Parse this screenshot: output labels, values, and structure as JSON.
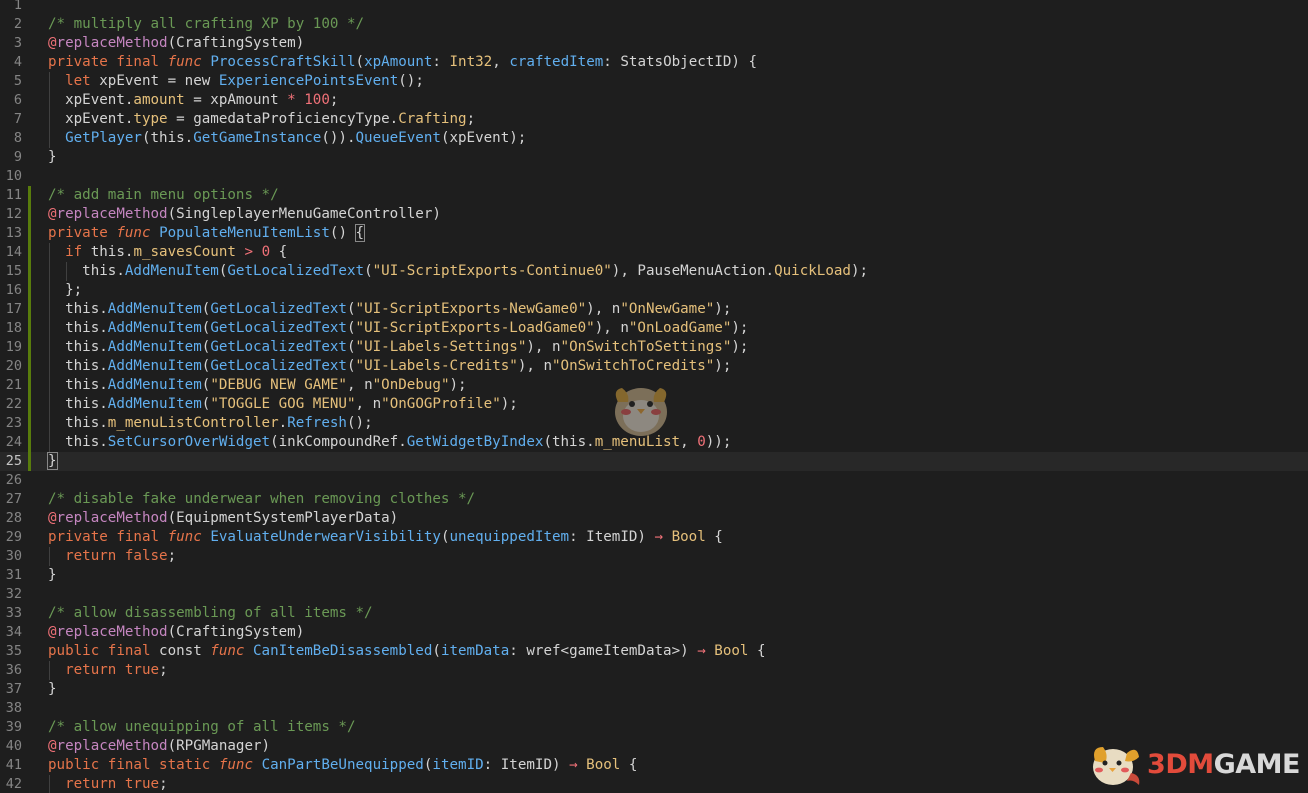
{
  "editor": {
    "current_line": 25,
    "lines": [
      {
        "n": "1",
        "tokens": []
      },
      {
        "n": "2",
        "tokens": [
          [
            "c",
            "/* multiply all crafting XP by 100 */"
          ]
        ]
      },
      {
        "n": "3",
        "tokens": [
          [
            "at",
            "@"
          ],
          [
            "d",
            "replaceMethod"
          ],
          [
            "p",
            "(CraftingSystem)"
          ]
        ]
      },
      {
        "n": "4",
        "tokens": [
          [
            "k",
            "private final "
          ],
          [
            "f",
            "func "
          ],
          [
            "fn",
            "ProcessCraftSkill"
          ],
          [
            "p",
            "("
          ],
          [
            "pa",
            "xpAmount"
          ],
          [
            "p",
            ": "
          ],
          [
            "t",
            "Int32"
          ],
          [
            "p",
            ", "
          ],
          [
            "pa",
            "craftedItem"
          ],
          [
            "p",
            ": StatsObjectID) {"
          ]
        ]
      },
      {
        "n": "5",
        "tokens": [
          [
            "p",
            "  "
          ],
          [
            "k",
            "let "
          ],
          [
            "p",
            "xpEvent = new "
          ],
          [
            "fn",
            "ExperiencePointsEvent"
          ],
          [
            "p",
            "();"
          ]
        ]
      },
      {
        "n": "6",
        "tokens": [
          [
            "p",
            "  xpEvent."
          ],
          [
            "pr",
            "amount"
          ],
          [
            "p",
            " = xpAmount "
          ],
          [
            "o",
            "*"
          ],
          [
            "p",
            " "
          ],
          [
            "nu",
            "100"
          ],
          [
            "p",
            ";"
          ]
        ]
      },
      {
        "n": "7",
        "tokens": [
          [
            "p",
            "  xpEvent."
          ],
          [
            "pr",
            "type"
          ],
          [
            "p",
            " = gamedataProficiencyType."
          ],
          [
            "pr",
            "Crafting"
          ],
          [
            "p",
            ";"
          ]
        ]
      },
      {
        "n": "8",
        "tokens": [
          [
            "p",
            "  "
          ],
          [
            "fn",
            "GetPlayer"
          ],
          [
            "p",
            "(this."
          ],
          [
            "fn",
            "GetGameInstance"
          ],
          [
            "p",
            "())."
          ],
          [
            "fn",
            "QueueEvent"
          ],
          [
            "p",
            "(xpEvent);"
          ]
        ]
      },
      {
        "n": "9",
        "tokens": [
          [
            "p",
            "}"
          ]
        ]
      },
      {
        "n": "10",
        "tokens": []
      },
      {
        "n": "11",
        "tokens": [
          [
            "c",
            "/* add main menu options */"
          ]
        ]
      },
      {
        "n": "12",
        "tokens": [
          [
            "at",
            "@"
          ],
          [
            "d",
            "replaceMethod"
          ],
          [
            "p",
            "(SingleplayerMenuGameController)"
          ]
        ]
      },
      {
        "n": "13",
        "tokens": [
          [
            "k",
            "private "
          ],
          [
            "f",
            "func "
          ],
          [
            "fn",
            "PopulateMenuItemList"
          ],
          [
            "p",
            "() "
          ],
          [
            "b",
            "{"
          ]
        ]
      },
      {
        "n": "14",
        "tokens": [
          [
            "p",
            "  "
          ],
          [
            "k",
            "if "
          ],
          [
            "p",
            "this."
          ],
          [
            "pr",
            "m_savesCount"
          ],
          [
            "p",
            " "
          ],
          [
            "o",
            ">"
          ],
          [
            "p",
            " "
          ],
          [
            "nu",
            "0"
          ],
          [
            "p",
            " {"
          ]
        ]
      },
      {
        "n": "15",
        "tokens": [
          [
            "p",
            "    this."
          ],
          [
            "fn",
            "AddMenuItem"
          ],
          [
            "p",
            "("
          ],
          [
            "fn",
            "GetLocalizedText"
          ],
          [
            "p",
            "("
          ],
          [
            "s",
            "\"UI-ScriptExports-Continue0\""
          ],
          [
            "p",
            "), PauseMenuAction."
          ],
          [
            "pr",
            "QuickLoad"
          ],
          [
            "p",
            ");"
          ]
        ]
      },
      {
        "n": "16",
        "tokens": [
          [
            "p",
            "  };"
          ]
        ]
      },
      {
        "n": "17",
        "tokens": [
          [
            "p",
            "  this."
          ],
          [
            "fn",
            "AddMenuItem"
          ],
          [
            "p",
            "("
          ],
          [
            "fn",
            "GetLocalizedText"
          ],
          [
            "p",
            "("
          ],
          [
            "s",
            "\"UI-ScriptExports-NewGame0\""
          ],
          [
            "p",
            "), n"
          ],
          [
            "s",
            "\"OnNewGame\""
          ],
          [
            "p",
            ");"
          ]
        ]
      },
      {
        "n": "18",
        "tokens": [
          [
            "p",
            "  this."
          ],
          [
            "fn",
            "AddMenuItem"
          ],
          [
            "p",
            "("
          ],
          [
            "fn",
            "GetLocalizedText"
          ],
          [
            "p",
            "("
          ],
          [
            "s",
            "\"UI-ScriptExports-LoadGame0\""
          ],
          [
            "p",
            "), n"
          ],
          [
            "s",
            "\"OnLoadGame\""
          ],
          [
            "p",
            ");"
          ]
        ]
      },
      {
        "n": "19",
        "tokens": [
          [
            "p",
            "  this."
          ],
          [
            "fn",
            "AddMenuItem"
          ],
          [
            "p",
            "("
          ],
          [
            "fn",
            "GetLocalizedText"
          ],
          [
            "p",
            "("
          ],
          [
            "s",
            "\"UI-Labels-Settings\""
          ],
          [
            "p",
            "), n"
          ],
          [
            "s",
            "\"OnSwitchToSettings\""
          ],
          [
            "p",
            ");"
          ]
        ]
      },
      {
        "n": "20",
        "tokens": [
          [
            "p",
            "  this."
          ],
          [
            "fn",
            "AddMenuItem"
          ],
          [
            "p",
            "("
          ],
          [
            "fn",
            "GetLocalizedText"
          ],
          [
            "p",
            "("
          ],
          [
            "s",
            "\"UI-Labels-Credits\""
          ],
          [
            "p",
            "), n"
          ],
          [
            "s",
            "\"OnSwitchToCredits\""
          ],
          [
            "p",
            ");"
          ]
        ]
      },
      {
        "n": "21",
        "tokens": [
          [
            "p",
            "  this."
          ],
          [
            "fn",
            "AddMenuItem"
          ],
          [
            "p",
            "("
          ],
          [
            "s",
            "\"DEBUG NEW GAME\""
          ],
          [
            "p",
            ", n"
          ],
          [
            "s",
            "\"OnDebug\""
          ],
          [
            "p",
            ");"
          ]
        ]
      },
      {
        "n": "22",
        "tokens": [
          [
            "p",
            "  this."
          ],
          [
            "fn",
            "AddMenuItem"
          ],
          [
            "p",
            "("
          ],
          [
            "s",
            "\"TOGGLE GOG MENU\""
          ],
          [
            "p",
            ", n"
          ],
          [
            "s",
            "\"OnGOGProfile\""
          ],
          [
            "p",
            ");"
          ]
        ]
      },
      {
        "n": "23",
        "tokens": [
          [
            "p",
            "  this."
          ],
          [
            "pr",
            "m_menuListController"
          ],
          [
            "p",
            "."
          ],
          [
            "fn",
            "Refresh"
          ],
          [
            "p",
            "();"
          ]
        ]
      },
      {
        "n": "24",
        "tokens": [
          [
            "p",
            "  this."
          ],
          [
            "fn",
            "SetCursorOverWidget"
          ],
          [
            "p",
            "(inkCompoundRef."
          ],
          [
            "fn",
            "GetWidgetByIndex"
          ],
          [
            "p",
            "(this."
          ],
          [
            "pr",
            "m_menuList"
          ],
          [
            "p",
            ", "
          ],
          [
            "nu",
            "0"
          ],
          [
            "p",
            "));"
          ]
        ]
      },
      {
        "n": "25",
        "tokens": [
          [
            "b",
            "}"
          ]
        ]
      },
      {
        "n": "26",
        "tokens": []
      },
      {
        "n": "27",
        "tokens": [
          [
            "c",
            "/* disable fake underwear when removing clothes */"
          ]
        ]
      },
      {
        "n": "28",
        "tokens": [
          [
            "at",
            "@"
          ],
          [
            "d",
            "replaceMethod"
          ],
          [
            "p",
            "(EquipmentSystemPlayerData)"
          ]
        ]
      },
      {
        "n": "29",
        "tokens": [
          [
            "k",
            "private final "
          ],
          [
            "f",
            "func "
          ],
          [
            "fn",
            "EvaluateUnderwearVisibility"
          ],
          [
            "p",
            "("
          ],
          [
            "pa",
            "unequippedItem"
          ],
          [
            "p",
            ": ItemID) "
          ],
          [
            "o",
            "→"
          ],
          [
            "p",
            " "
          ],
          [
            "t",
            "Bool"
          ],
          [
            "p",
            " {"
          ]
        ]
      },
      {
        "n": "30",
        "tokens": [
          [
            "p",
            "  "
          ],
          [
            "k",
            "return "
          ],
          [
            "k",
            "false"
          ],
          [
            "p",
            ";"
          ]
        ]
      },
      {
        "n": "31",
        "tokens": [
          [
            "p",
            "}"
          ]
        ]
      },
      {
        "n": "32",
        "tokens": []
      },
      {
        "n": "33",
        "tokens": [
          [
            "c",
            "/* allow disassembling of all items */"
          ]
        ]
      },
      {
        "n": "34",
        "tokens": [
          [
            "at",
            "@"
          ],
          [
            "d",
            "replaceMethod"
          ],
          [
            "p",
            "(CraftingSystem)"
          ]
        ]
      },
      {
        "n": "35",
        "tokens": [
          [
            "k",
            "public final "
          ],
          [
            "p",
            "const "
          ],
          [
            "f",
            "func "
          ],
          [
            "fn",
            "CanItemBeDisassembled"
          ],
          [
            "p",
            "("
          ],
          [
            "pa",
            "itemData"
          ],
          [
            "p",
            ": wref<gameItemData>) "
          ],
          [
            "o",
            "→"
          ],
          [
            "p",
            " "
          ],
          [
            "t",
            "Bool"
          ],
          [
            "p",
            " {"
          ]
        ]
      },
      {
        "n": "36",
        "tokens": [
          [
            "p",
            "  "
          ],
          [
            "k",
            "return "
          ],
          [
            "k",
            "true"
          ],
          [
            "p",
            ";"
          ]
        ]
      },
      {
        "n": "37",
        "tokens": [
          [
            "p",
            "}"
          ]
        ]
      },
      {
        "n": "38",
        "tokens": []
      },
      {
        "n": "39",
        "tokens": [
          [
            "c",
            "/* allow unequipping of all items */"
          ]
        ]
      },
      {
        "n": "40",
        "tokens": [
          [
            "at",
            "@"
          ],
          [
            "d",
            "replaceMethod"
          ],
          [
            "p",
            "(RPGManager)"
          ]
        ]
      },
      {
        "n": "41",
        "tokens": [
          [
            "k",
            "public final static "
          ],
          [
            "f",
            "func "
          ],
          [
            "fn",
            "CanPartBeUnequipped"
          ],
          [
            "p",
            "("
          ],
          [
            "pa",
            "itemID"
          ],
          [
            "p",
            ": ItemID) "
          ],
          [
            "o",
            "→"
          ],
          [
            "p",
            " "
          ],
          [
            "t",
            "Bool"
          ],
          [
            "p",
            " {"
          ]
        ]
      },
      {
        "n": "42",
        "tokens": [
          [
            "p",
            "  "
          ],
          [
            "k",
            "return "
          ],
          [
            "k",
            "true"
          ],
          [
            "p",
            ";"
          ]
        ]
      }
    ]
  },
  "watermark": {
    "prefix": "3DM",
    "suffix": "GAME"
  },
  "icons": {
    "mascot": "bird-mascot-icon",
    "watermark_logo": "3dm-bird-logo-icon"
  },
  "colors": {
    "background": "#1e1e1e",
    "line_number": "#858585",
    "comment": "#6a9955",
    "keyword": "#e6744a",
    "function_name": "#61afef",
    "string": "#e5c07b",
    "number": "#f07178",
    "change_bar": "#587c0c"
  }
}
